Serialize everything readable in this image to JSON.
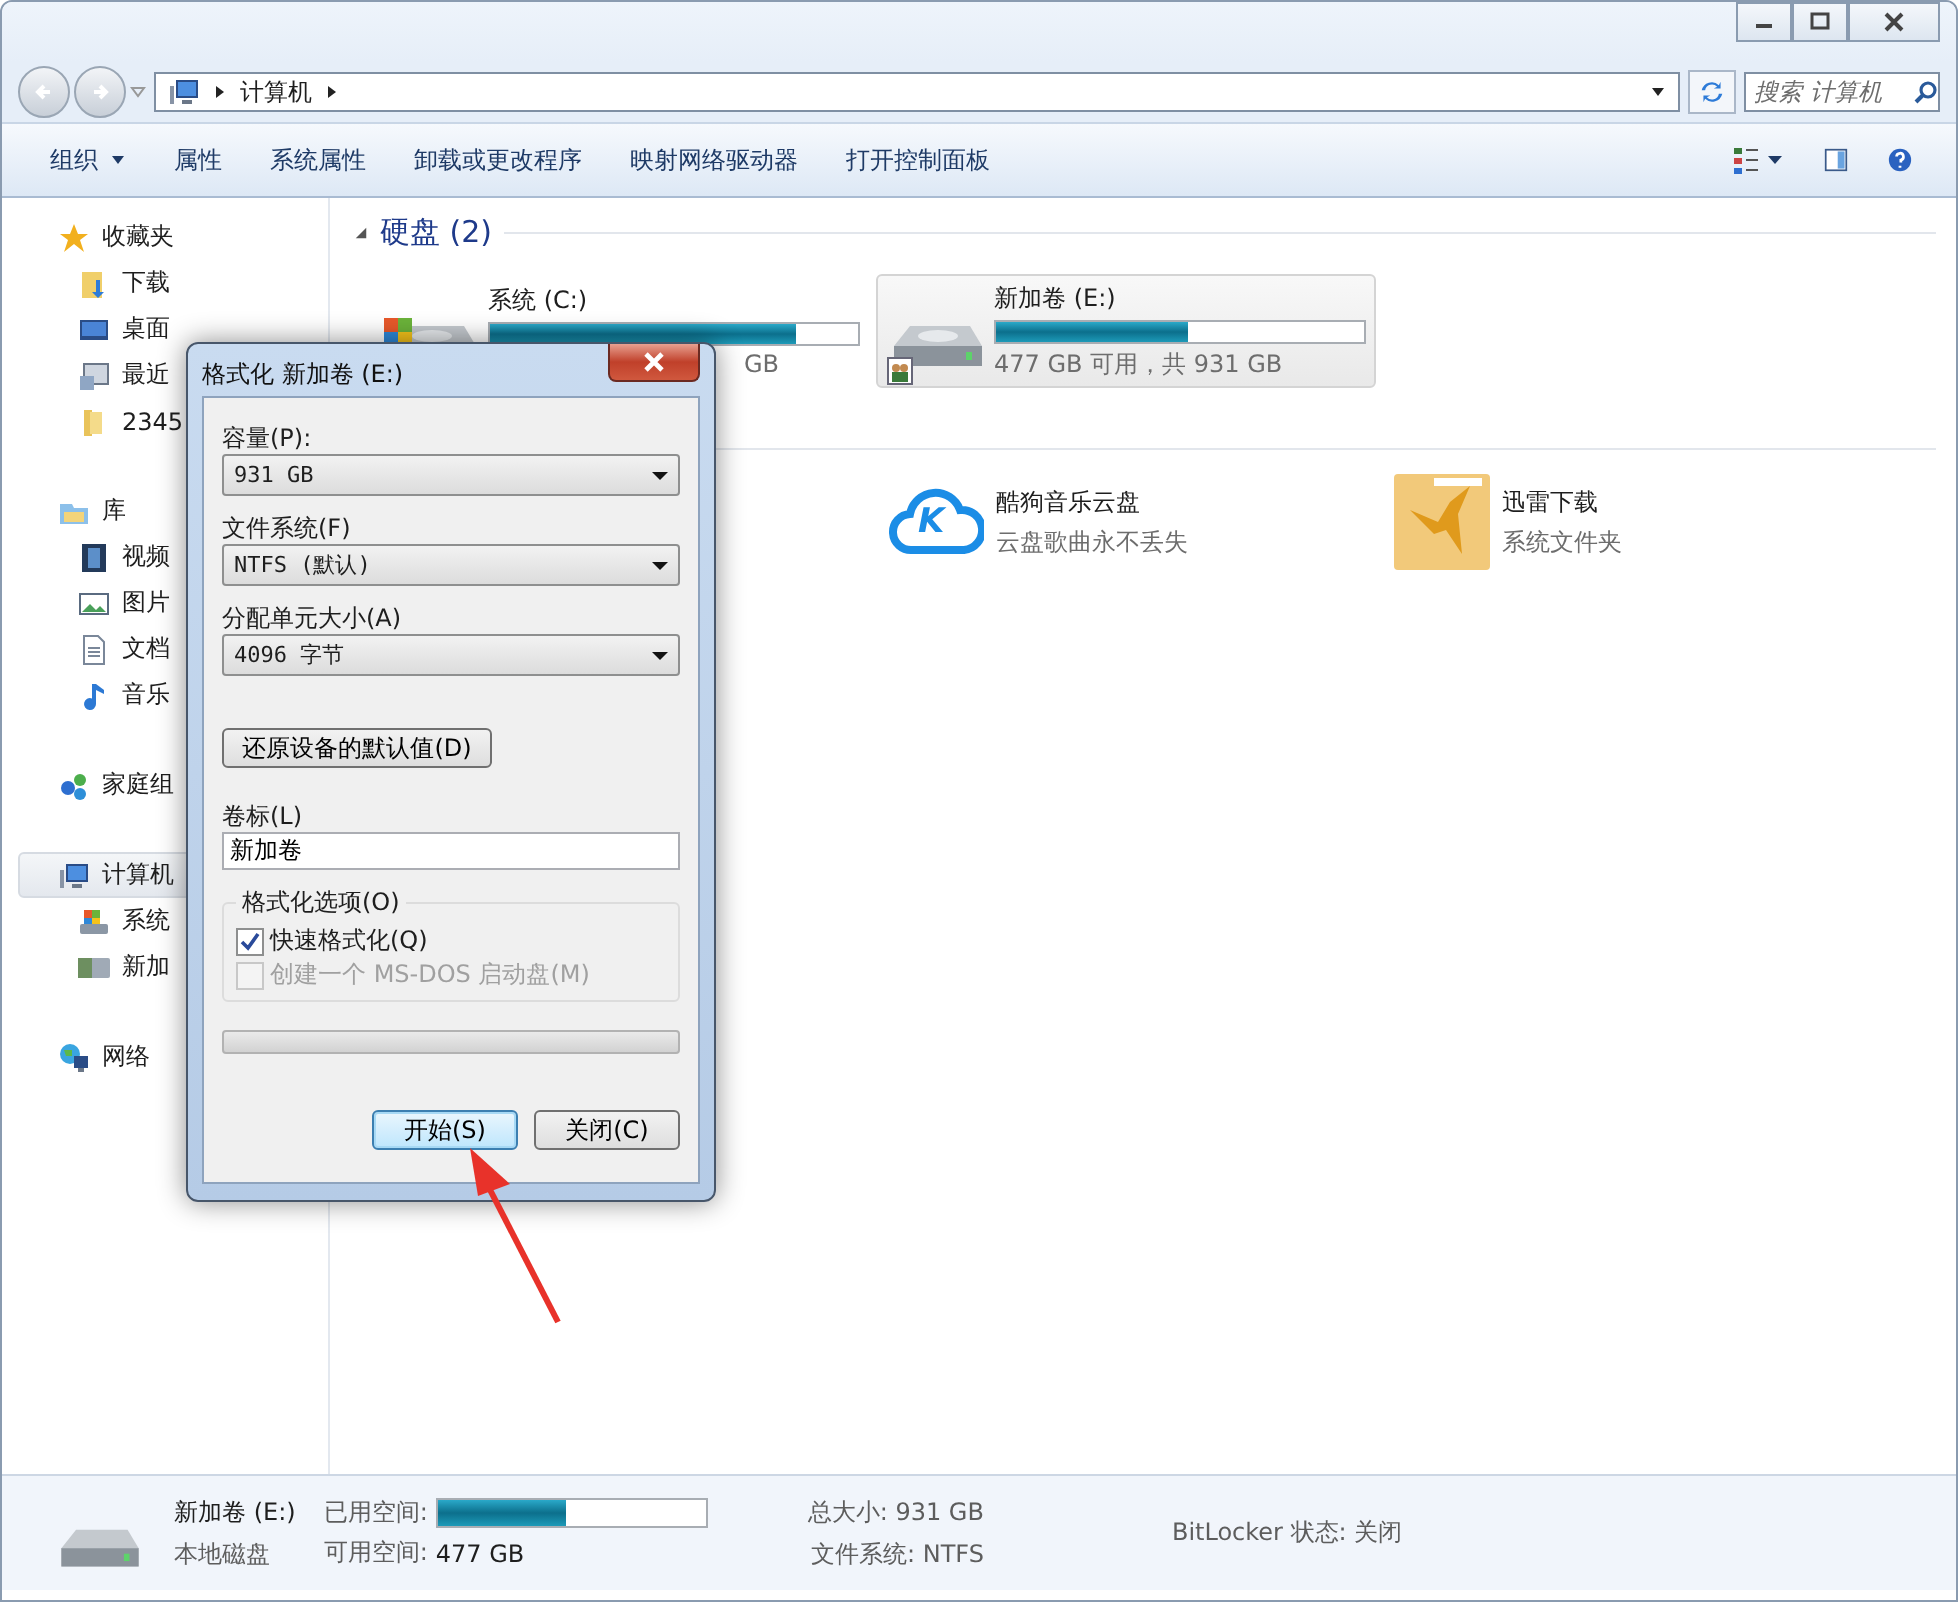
{
  "window": {
    "path": [
      "计算机"
    ],
    "search": {
      "placeholder": "搜索 计算机"
    }
  },
  "toolbar": [
    {
      "label": "组织",
      "kind": "menu"
    },
    {
      "label": "属性",
      "kind": "command"
    },
    {
      "label": "系统属性",
      "kind": "command"
    },
    {
      "label": "卸载或更改程序",
      "kind": "command"
    },
    {
      "label": "映射网络驱动器",
      "kind": "command"
    },
    {
      "label": "打开控制面板",
      "kind": "command"
    }
  ],
  "sidebar": [
    {
      "label": "收藏夹",
      "kind": "star",
      "selected": false,
      "children": [
        {
          "label": "下载",
          "kind": "download",
          "selected": false
        },
        {
          "label": "桌面",
          "kind": "desktop",
          "selected": false
        },
        {
          "label": "最近",
          "kind": "recent",
          "selected": false
        },
        {
          "label": "2345",
          "kind": "folder",
          "selected": false
        }
      ]
    },
    {
      "label": "库",
      "kind": "library",
      "selected": false,
      "children": [
        {
          "label": "视频",
          "kind": "video",
          "selected": false
        },
        {
          "label": "图片",
          "kind": "picture",
          "selected": false
        },
        {
          "label": "文档",
          "kind": "document",
          "selected": false
        },
        {
          "label": "音乐",
          "kind": "music",
          "selected": false
        }
      ]
    },
    {
      "label": "家庭组",
      "kind": "homegroup",
      "selected": false
    },
    {
      "label": "计算机",
      "kind": "computer",
      "selected": true,
      "children": [
        {
          "label": "系统",
          "kind": "system-drive",
          "selected": false
        },
        {
          "label": "新加",
          "kind": "drive",
          "selected": false
        }
      ]
    },
    {
      "label": "网络",
      "kind": "network",
      "selected": false
    }
  ],
  "section": {
    "title": "硬盘 (2)",
    "expanded": true
  },
  "drives": [
    {
      "name": "系统 (C:)",
      "kind": "system",
      "level": 0.83,
      "free": "GB",
      "selected": false
    },
    {
      "name": "新加卷 (E:)",
      "kind": "shared",
      "level": 0.52,
      "free": "477 GB 可用，共 931 GB",
      "selected": true
    }
  ],
  "others": [
    {
      "title": "酷狗音乐云盘",
      "subtitle": "云盘歌曲永不丢失",
      "kind": "cloud",
      "badge": "K"
    },
    {
      "title": "迅雷下载",
      "subtitle": "系统文件夹",
      "kind": "folder"
    }
  ],
  "dialog": {
    "title": "格式化 新加卷 (E:)",
    "selects": [
      {
        "label": "容量(P):",
        "value": "931 GB"
      },
      {
        "label": "文件系统(F)",
        "value": "NTFS (默认)"
      },
      {
        "label": "分配单元大小(A)",
        "value": "4096 字节"
      }
    ],
    "restore": "还原设备的默认值(D)",
    "volume": {
      "label": "卷标(L)",
      "value": "新加卷"
    },
    "options_title": "格式化选项(O)",
    "options": [
      {
        "label": "快速格式化(Q)",
        "checked": true,
        "disabled": false
      },
      {
        "label": "创建一个 MS-DOS 启动盘(M)",
        "checked": false,
        "disabled": true
      }
    ],
    "progress": {
      "level": 0
    },
    "buttons": [
      {
        "label": "开始(S)",
        "default": true
      },
      {
        "label": "关闭(C)",
        "default": false
      }
    ]
  },
  "status": {
    "name": "新加卷 (E:)",
    "type": "本地磁盘",
    "used_label": "已用空间:",
    "level": 0.48,
    "free_label": "可用空间:",
    "free": "477 GB",
    "total": "总大小: 931 GB",
    "fs": "文件系统: NTFS",
    "bitlocker": "BitLocker 状态: 关闭"
  }
}
